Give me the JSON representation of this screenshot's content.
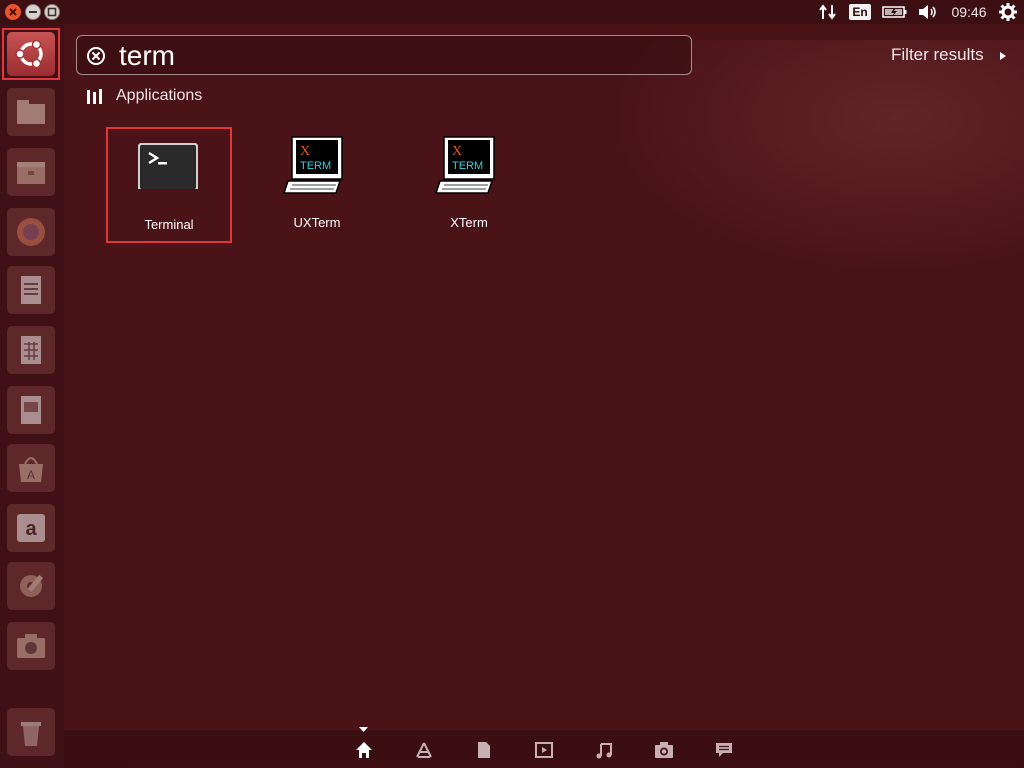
{
  "panel": {
    "keyboard_layout": "En",
    "clock": "09:46",
    "icons": [
      "network-icon",
      "keyboard-icon",
      "battery-icon",
      "volume-icon",
      "power-gear-icon"
    ]
  },
  "window_controls": [
    "close-icon",
    "minimize-icon",
    "maximize-icon"
  ],
  "launcher": {
    "items": [
      {
        "name": "dash-home",
        "icon": "ubuntu-logo-icon"
      },
      {
        "name": "files",
        "icon": "files-icon"
      },
      {
        "name": "archive",
        "icon": "archive-icon"
      },
      {
        "name": "firefox",
        "icon": "firefox-icon"
      },
      {
        "name": "writer",
        "icon": "document-icon"
      },
      {
        "name": "calc",
        "icon": "spreadsheet-icon"
      },
      {
        "name": "impress",
        "icon": "presentation-icon"
      },
      {
        "name": "software-center",
        "icon": "software-center-icon"
      },
      {
        "name": "amazon",
        "icon": "amazon-icon"
      },
      {
        "name": "system-settings",
        "icon": "settings-icon"
      },
      {
        "name": "screenshot",
        "icon": "camera-icon"
      },
      {
        "name": "trash",
        "icon": "trash-icon"
      }
    ]
  },
  "search": {
    "query": "term",
    "filter_label": "Filter results"
  },
  "category": {
    "label": "Applications"
  },
  "apps": [
    {
      "label": "Terminal",
      "icon": "terminal-icon",
      "selected": true
    },
    {
      "label": "UXTerm",
      "icon": "xterm-icon",
      "selected": false
    },
    {
      "label": "XTerm",
      "icon": "xterm-icon",
      "selected": false
    }
  ],
  "xterm_icon_text": {
    "x": "X",
    "term": "TERM"
  },
  "lenses": [
    "home-icon",
    "applications-icon",
    "files-icon",
    "video-icon",
    "music-icon",
    "photo-icon",
    "social-icon"
  ],
  "colors": {
    "background": "#4a1318",
    "selection": "#e0383a"
  }
}
